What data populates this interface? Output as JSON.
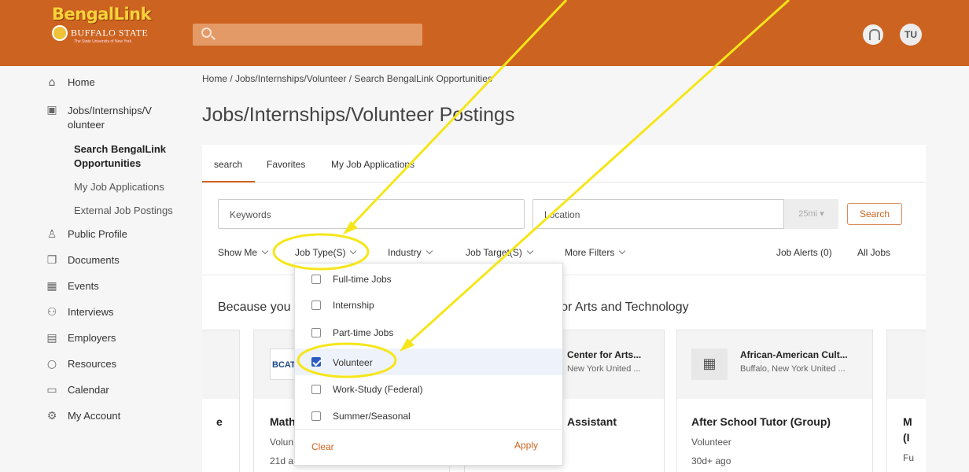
{
  "header": {
    "brand_top": "BengalLink",
    "brand_state": "BUFFALO STATE",
    "brand_sub": "The State University of New York",
    "avatar_initials": "TU",
    "accent_color": "#cd6320"
  },
  "sidebar": {
    "items": [
      {
        "label": "Home",
        "icon": "home-icon"
      },
      {
        "label": "Jobs/Internships/V",
        "label2": "olunteer",
        "icon": "briefcase-icon"
      },
      {
        "label": "Public Profile",
        "icon": "person-icon"
      },
      {
        "label": "Documents",
        "icon": "documents-icon"
      },
      {
        "label": "Events",
        "icon": "calendar-events-icon"
      },
      {
        "label": "Interviews",
        "icon": "interviews-icon"
      },
      {
        "label": "Employers",
        "icon": "building-icon"
      },
      {
        "label": "Resources",
        "icon": "lightbulb-icon"
      },
      {
        "label": "Calendar",
        "icon": "calendar-icon"
      },
      {
        "label": "My Account",
        "icon": "gear-icon"
      }
    ],
    "subitems": {
      "search_1": "Search BengalLink",
      "search_2": "Opportunities",
      "applications": "My Job Applications",
      "external": "External Job Postings"
    }
  },
  "main": {
    "breadcrumb": "Home / Jobs/Internships/Volunteer / Search BengalLink Opportunities",
    "title": "Jobs/Internships/Volunteer Postings",
    "tabs": [
      {
        "label": "search"
      },
      {
        "label": "Favorites"
      },
      {
        "label": "My Job Applications"
      }
    ],
    "keywords_placeholder": "Keywords",
    "location_placeholder": "Location",
    "radius": "25mi",
    "search_button": "Search",
    "filters": {
      "show_me": "Show Me",
      "job_type": "Job Type(S)",
      "industry": "Industry",
      "job_target": "Job Target(S)",
      "more": "More Filters",
      "alerts": "Job Alerts (0)",
      "all_jobs": "All Jobs"
    },
    "section_title_left": "Because you",
    "section_title_right": "er for Arts and Technology"
  },
  "cards": [
    {
      "org": "Center for Arts...",
      "city": "New York United ...",
      "title": "Math",
      "title_right": "Assistant",
      "type": "Volun",
      "age": "21d a",
      "logo_text": "BCAT"
    },
    {
      "org": "African-American Cult...",
      "city": "Buffalo, New York United ...",
      "title": "After School Tutor (Group)",
      "type": "Volunteer",
      "age": "30d+ ago"
    }
  ],
  "card_edge": {
    "left_letter": "e",
    "right_title": "M",
    "right_title2": "(I",
    "right_type": "Fu"
  },
  "dropdown": {
    "options": [
      {
        "label": "Full-time Jobs",
        "checked": false
      },
      {
        "label": "Internship",
        "checked": false
      },
      {
        "label": "Part-time Jobs",
        "checked": false
      },
      {
        "label": "Volunteer",
        "checked": true
      },
      {
        "label": "Work-Study (Federal)",
        "checked": false
      },
      {
        "label": "Summer/Seasonal",
        "checked": false
      }
    ],
    "clear": "Clear",
    "apply": "Apply"
  },
  "annotation_color": "#f5e61a"
}
